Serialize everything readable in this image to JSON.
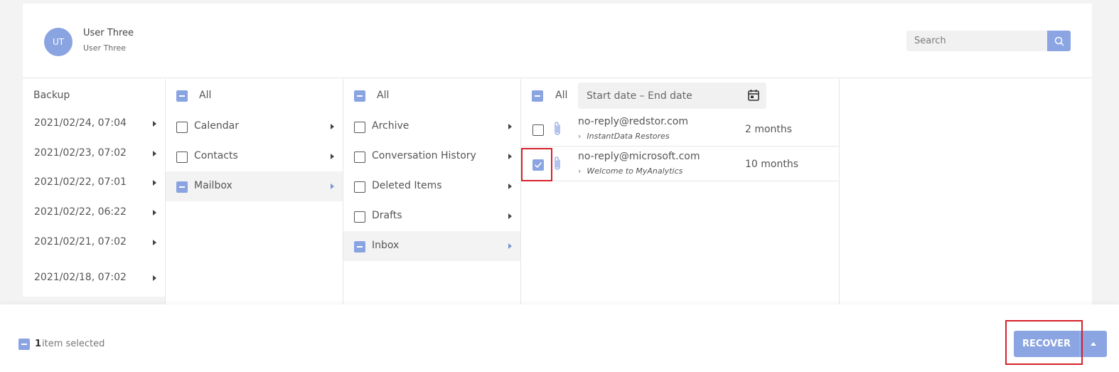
{
  "user": {
    "initials": "UT",
    "name": "User Three",
    "subtitle": "User Three"
  },
  "search": {
    "placeholder": "Search"
  },
  "backup": {
    "header": "Backup",
    "items": [
      {
        "label": "2021/02/24, 07:04"
      },
      {
        "label": "2021/02/23, 07:02"
      },
      {
        "label": "2021/02/22, 07:01"
      },
      {
        "label": "2021/02/22, 06:22"
      },
      {
        "label": "2021/02/21, 07:02"
      },
      {
        "label": "2021/02/18, 07:02"
      }
    ]
  },
  "folders": {
    "all_label": "All",
    "items": [
      {
        "label": "Calendar",
        "state": "unchecked"
      },
      {
        "label": "Contacts",
        "state": "unchecked"
      },
      {
        "label": "Mailbox",
        "state": "partial",
        "selected": true
      }
    ]
  },
  "subfolders": {
    "all_label": "All",
    "items": [
      {
        "label": "Archive",
        "state": "unchecked"
      },
      {
        "label": "Conversation History",
        "state": "unchecked"
      },
      {
        "label": "Deleted Items",
        "state": "unchecked"
      },
      {
        "label": "Drafts",
        "state": "unchecked"
      },
      {
        "label": "Inbox",
        "state": "partial",
        "selected": true
      }
    ]
  },
  "mails": {
    "all_label": "All",
    "date_range_placeholder": "Start date – End date",
    "items": [
      {
        "from": "no-reply@redstor.com",
        "subject": "InstantData Restores",
        "age": "2 months",
        "checked": false
      },
      {
        "from": "no-reply@microsoft.com",
        "subject": "Welcome to MyAnalytics",
        "age": "10 months",
        "checked": true
      }
    ]
  },
  "footer": {
    "count": "1",
    "selected_text": "item selected",
    "recover_label": "RECOVER"
  },
  "colors": {
    "accent": "#8ba5e3",
    "highlight": "#d6202a"
  },
  "icons": [
    "search-icon",
    "calendar-icon",
    "paperclip-icon",
    "check-icon",
    "chevron-right-icon",
    "caret-up-icon"
  ]
}
